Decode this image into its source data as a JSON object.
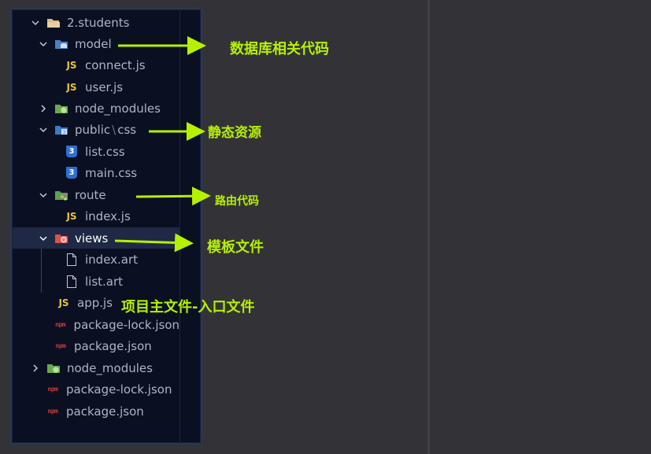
{
  "explorer": {
    "rows": [
      {
        "label": "2.students"
      },
      {
        "label": "model"
      },
      {
        "label": "connect.js"
      },
      {
        "label": "user.js"
      },
      {
        "label": "node_modules"
      },
      {
        "label": "public",
        "label2": "css",
        "separator": "\\"
      },
      {
        "label": "list.css"
      },
      {
        "label": "main.css"
      },
      {
        "label": "route"
      },
      {
        "label": "index.js"
      },
      {
        "label": "views"
      },
      {
        "label": "index.art"
      },
      {
        "label": "list.art"
      },
      {
        "label": "app.js"
      },
      {
        "label": "package-lock.json"
      },
      {
        "label": "package.json"
      },
      {
        "label": "node_modules"
      },
      {
        "label": "package-lock.json"
      },
      {
        "label": "package.json"
      }
    ],
    "js_badge": "JS",
    "npm_badge": "npm",
    "css_badge": "3"
  },
  "annotations": [
    {
      "text": "数据库相关代码"
    },
    {
      "text": "静态资源"
    },
    {
      "text": "路由代码"
    },
    {
      "text": "模板文件"
    },
    {
      "text": "项目主文件-入口文件"
    }
  ],
  "colors": {
    "annotation": "#b6f000",
    "panel_bg": "#0a1022",
    "editor_bg": "#333337",
    "selection": "#1f2844"
  }
}
